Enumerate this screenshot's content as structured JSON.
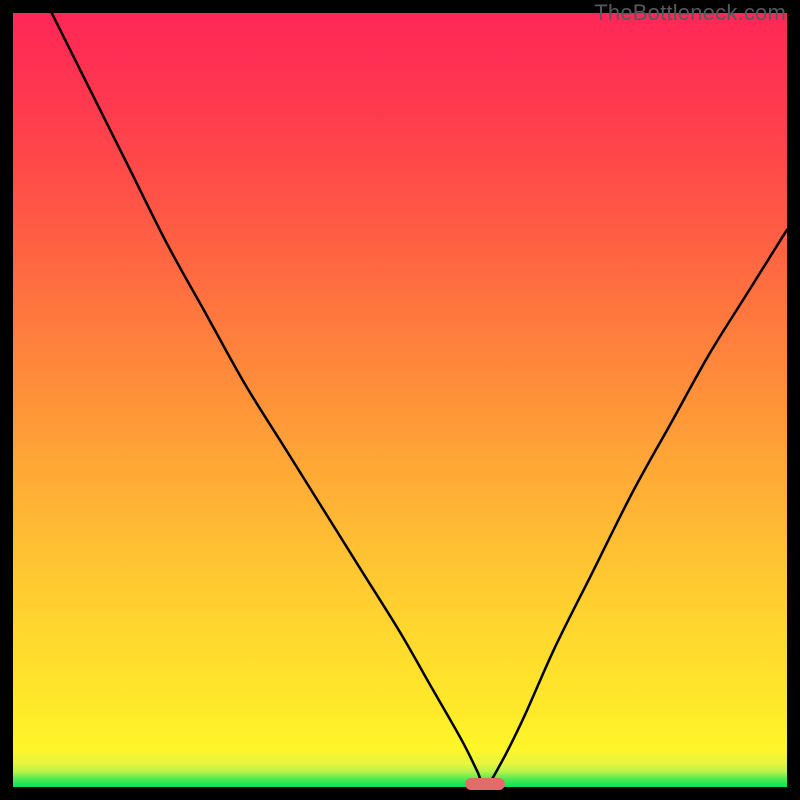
{
  "watermark": "TheBottleneck.com",
  "chart_data": {
    "type": "line",
    "title": "",
    "xlabel": "",
    "ylabel": "",
    "xlim": [
      0,
      100
    ],
    "ylim": [
      0,
      100
    ],
    "grid": false,
    "series": [
      {
        "name": "bottleneck-curve",
        "x": [
          0,
          5,
          10,
          15,
          20,
          25,
          30,
          35,
          40,
          45,
          50,
          54,
          58,
          60,
          61,
          63,
          66,
          70,
          75,
          80,
          85,
          90,
          95,
          100
        ],
        "values": [
          110,
          100,
          90,
          80,
          70,
          61,
          52,
          44,
          36,
          28,
          20,
          13,
          6,
          2,
          0,
          3,
          9,
          18,
          28,
          38,
          47,
          56,
          64,
          72
        ]
      }
    ],
    "marker": {
      "x": 61,
      "y": 0,
      "color": "#e36c6a"
    }
  }
}
